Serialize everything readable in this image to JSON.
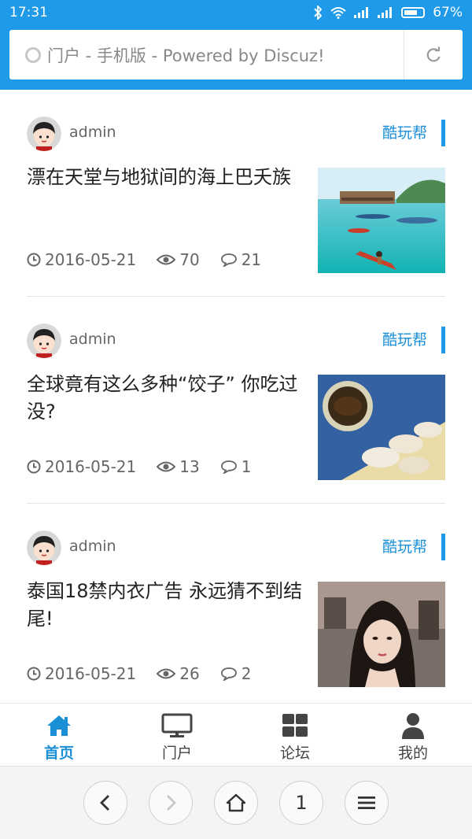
{
  "status_bar": {
    "time": "17:31",
    "battery": "67%",
    "battery_level": 0.67
  },
  "address_bar": {
    "text": "门户 - 手机版 - Powered by Discuz!"
  },
  "posts": [
    {
      "author": "admin",
      "category": "酷玩帮",
      "title": "漂在天堂与地狱间的海上巴夭族",
      "date": "2016-05-21",
      "views": "70",
      "comments": "21"
    },
    {
      "author": "admin",
      "category": "酷玩帮",
      "title": "全球竟有这么多种“饺子” 你吃过没?",
      "date": "2016-05-21",
      "views": "13",
      "comments": "1"
    },
    {
      "author": "admin",
      "category": "酷玩帮",
      "title": "泰国18禁内衣广告 永远猜不到结尾!",
      "date": "2016-05-21",
      "views": "26",
      "comments": "2"
    }
  ],
  "tabbar": {
    "home": "首页",
    "portal": "门户",
    "forum": "论坛",
    "me": "我的"
  },
  "browser": {
    "tab_count": "1"
  },
  "colors": {
    "accent": "#1e9ae8",
    "link": "#1a8fd6"
  }
}
